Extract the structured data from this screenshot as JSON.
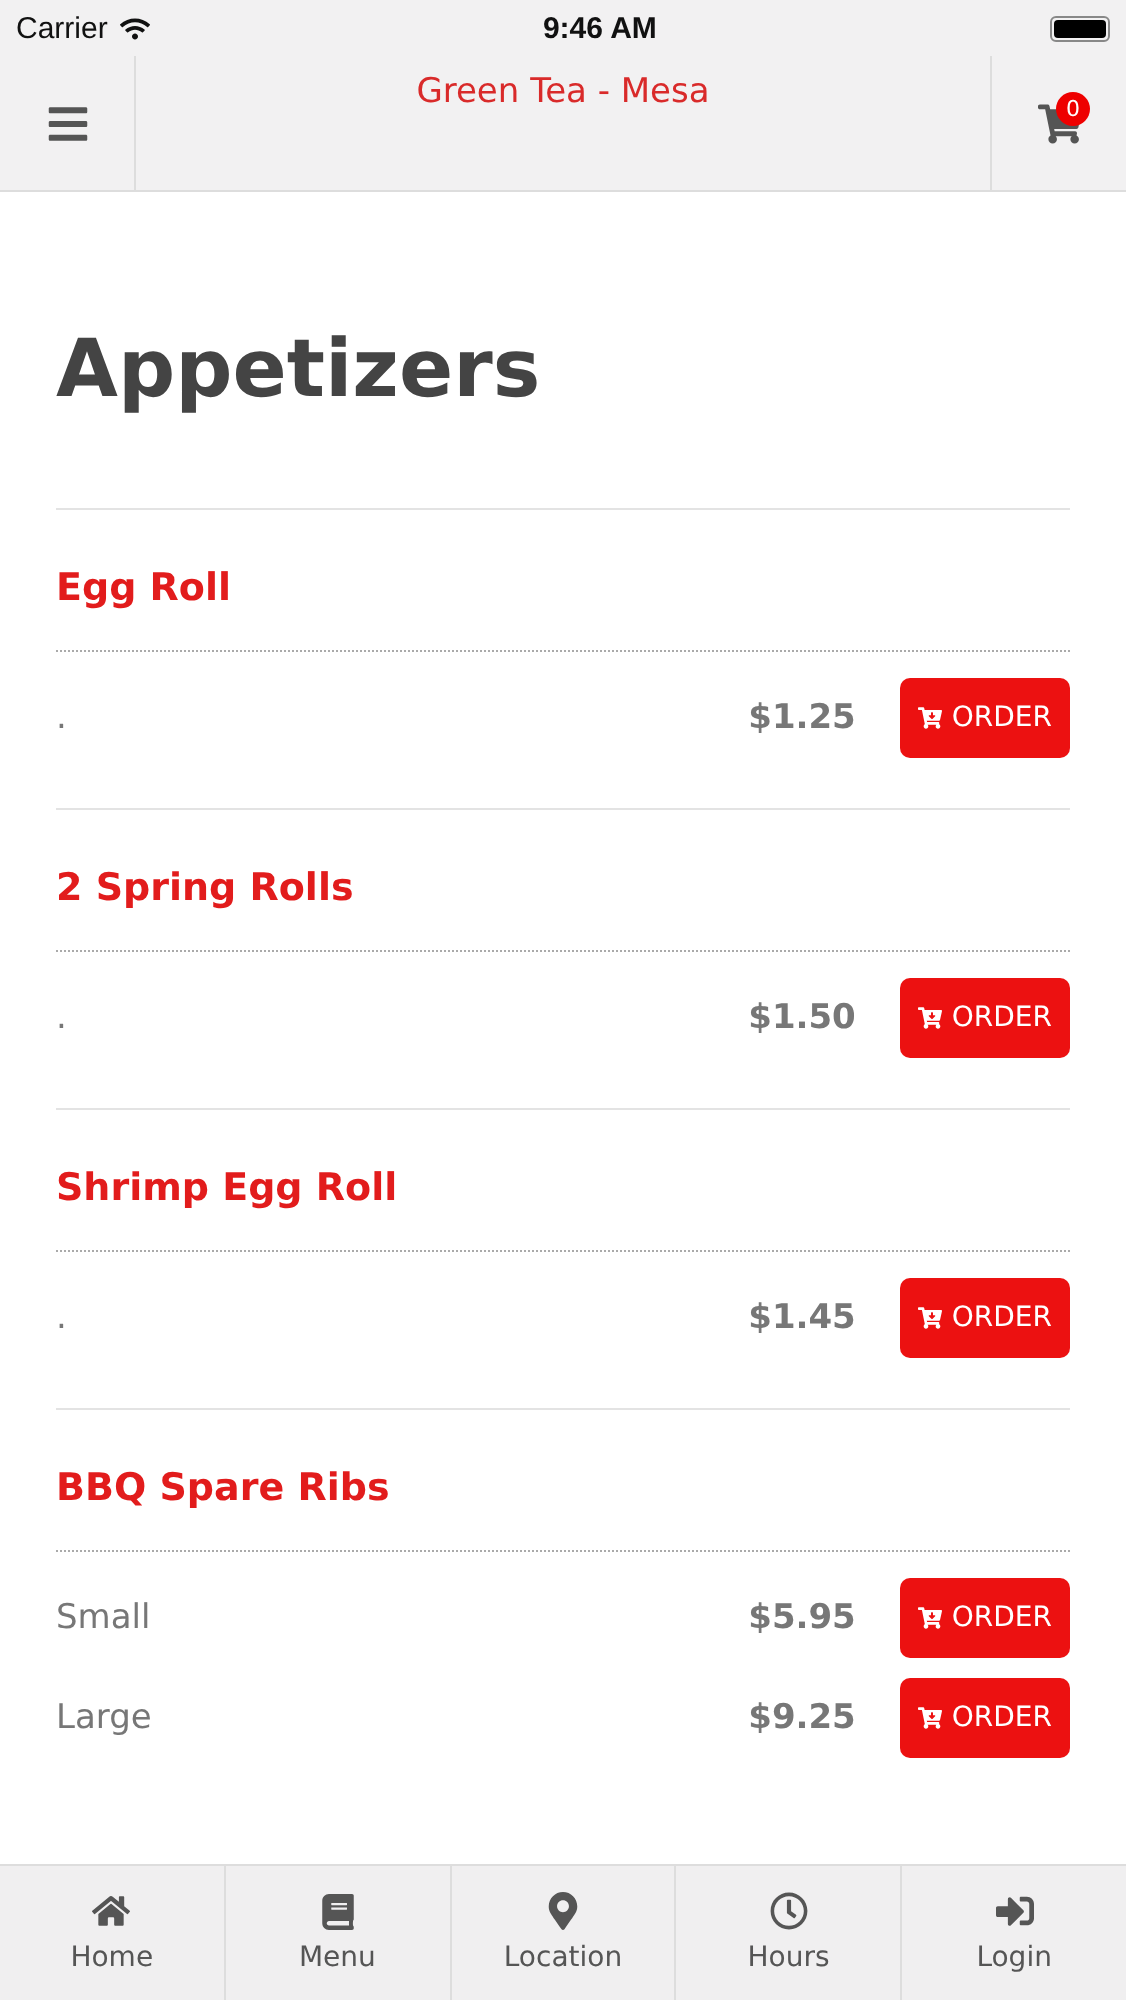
{
  "status_bar": {
    "carrier": "Carrier",
    "time": "9:46 AM"
  },
  "header": {
    "title": "Green Tea - Mesa",
    "cart_count": "0"
  },
  "section": {
    "title": "Appetizers"
  },
  "items": [
    {
      "name": "Egg Roll",
      "options": [
        {
          "label": ".",
          "price": "$1.25",
          "button": "ORDER"
        }
      ]
    },
    {
      "name": "2 Spring Rolls",
      "options": [
        {
          "label": ".",
          "price": "$1.50",
          "button": "ORDER"
        }
      ]
    },
    {
      "name": "Shrimp Egg Roll",
      "options": [
        {
          "label": ".",
          "price": "$1.45",
          "button": "ORDER"
        }
      ]
    },
    {
      "name": "BBQ Spare Ribs",
      "options": [
        {
          "label": "Small",
          "price": "$5.95",
          "button": "ORDER"
        },
        {
          "label": "Large",
          "price": "$9.25",
          "button": "ORDER"
        }
      ]
    }
  ],
  "tab_bar": [
    {
      "kind": "home",
      "label": "Home"
    },
    {
      "kind": "menu",
      "label": "Menu"
    },
    {
      "kind": "location",
      "label": "Location"
    },
    {
      "kind": "hours",
      "label": "Hours"
    },
    {
      "kind": "login",
      "label": "Login"
    }
  ]
}
